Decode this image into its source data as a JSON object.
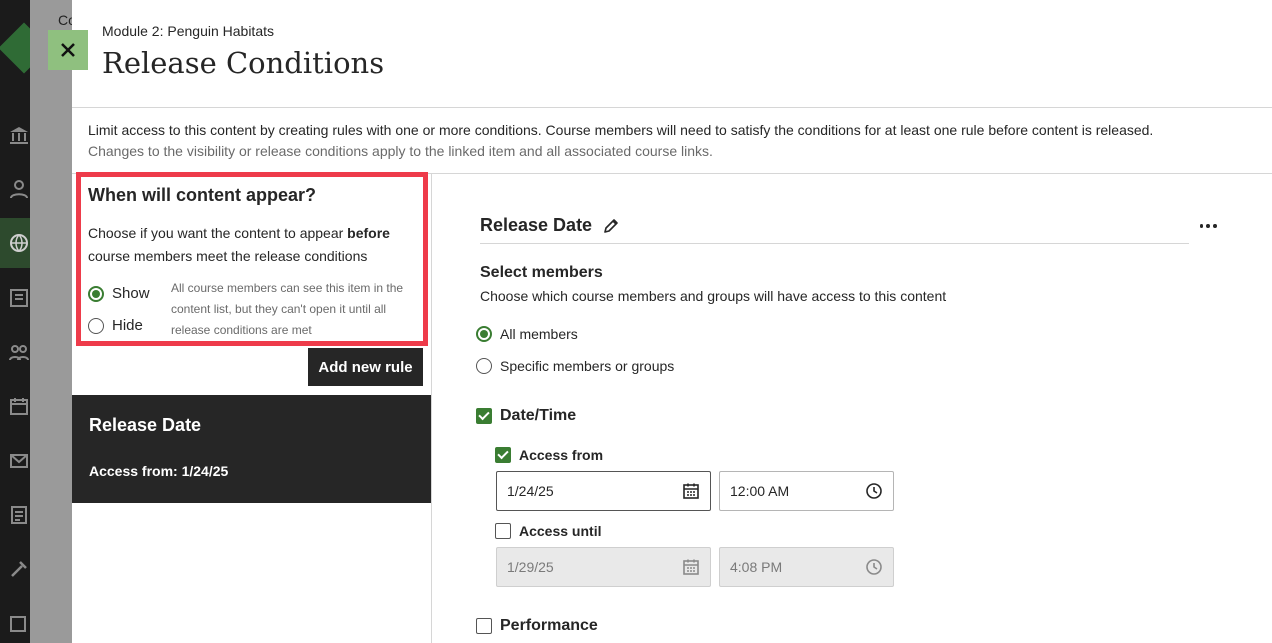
{
  "backdrop": {
    "peek_text": "Co"
  },
  "header": {
    "module": "Module 2: Penguin Habitats",
    "title": "Release Conditions"
  },
  "intro": {
    "line1": "Limit access to this content by creating rules with one or more conditions. Course members will need to satisfy the conditions for at least one rule before content is released.",
    "line2": "Changes to the visibility or release conditions apply to the linked item and all associated course links."
  },
  "appear": {
    "question": "When will content appear?",
    "desc_pre": "Choose if you want the content to appear ",
    "desc_bold": "before",
    "desc_post": " course members meet the release conditions",
    "show_label": "Show",
    "hide_label": "Hide",
    "selected": "Show",
    "hint": "All course members can see this item in the content list, but they can't open it until all release conditions are met"
  },
  "rules": {
    "add_label": "Add new rule",
    "items": [
      {
        "title": "Release Date",
        "summary": "Access from: 1/24/25"
      }
    ]
  },
  "rule_detail": {
    "title": "Release Date",
    "select_members_title": "Select members",
    "select_members_desc": "Choose which course members and groups will have access to this content",
    "member_options": [
      "All members",
      "Specific members or groups"
    ],
    "member_selected": "All members",
    "datetime_label": "Date/Time",
    "datetime_checked": true,
    "access_from_label": "Access from",
    "access_from_checked": true,
    "access_from_date": "1/24/25",
    "access_from_time": "12:00 AM",
    "access_until_label": "Access until",
    "access_until_checked": false,
    "access_until_date": "1/29/25",
    "access_until_time": "4:08 PM",
    "performance_label": "Performance",
    "performance_checked": false
  },
  "icons": {
    "close": "close-icon",
    "edit": "pencil-icon",
    "more": "more-options-icon",
    "calendar": "calendar-icon",
    "clock": "clock-icon"
  },
  "colors": {
    "accent_green": "#3a7d32",
    "close_bg": "#8fc07f",
    "highlight_red": "#ee3b4a",
    "dark": "#262626"
  }
}
